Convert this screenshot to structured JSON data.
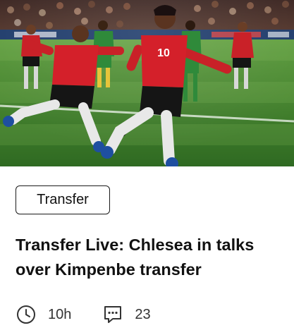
{
  "card": {
    "tag_label": "Transfer",
    "title": "Transfer Live: Chlesea in talks over Kimpenbe transfer",
    "meta": {
      "time": "10h",
      "time_icon": "clock-icon",
      "comments": "23",
      "comments_icon": "comment-icon"
    },
    "player_number": "10",
    "colors": {
      "jersey_red": "#d4202a",
      "shorts_black": "#151515",
      "pitch_green": "#3d7a2a",
      "opponent_green": "#2f8a3a",
      "text": "#111111",
      "border": "#1a1a1a"
    }
  }
}
